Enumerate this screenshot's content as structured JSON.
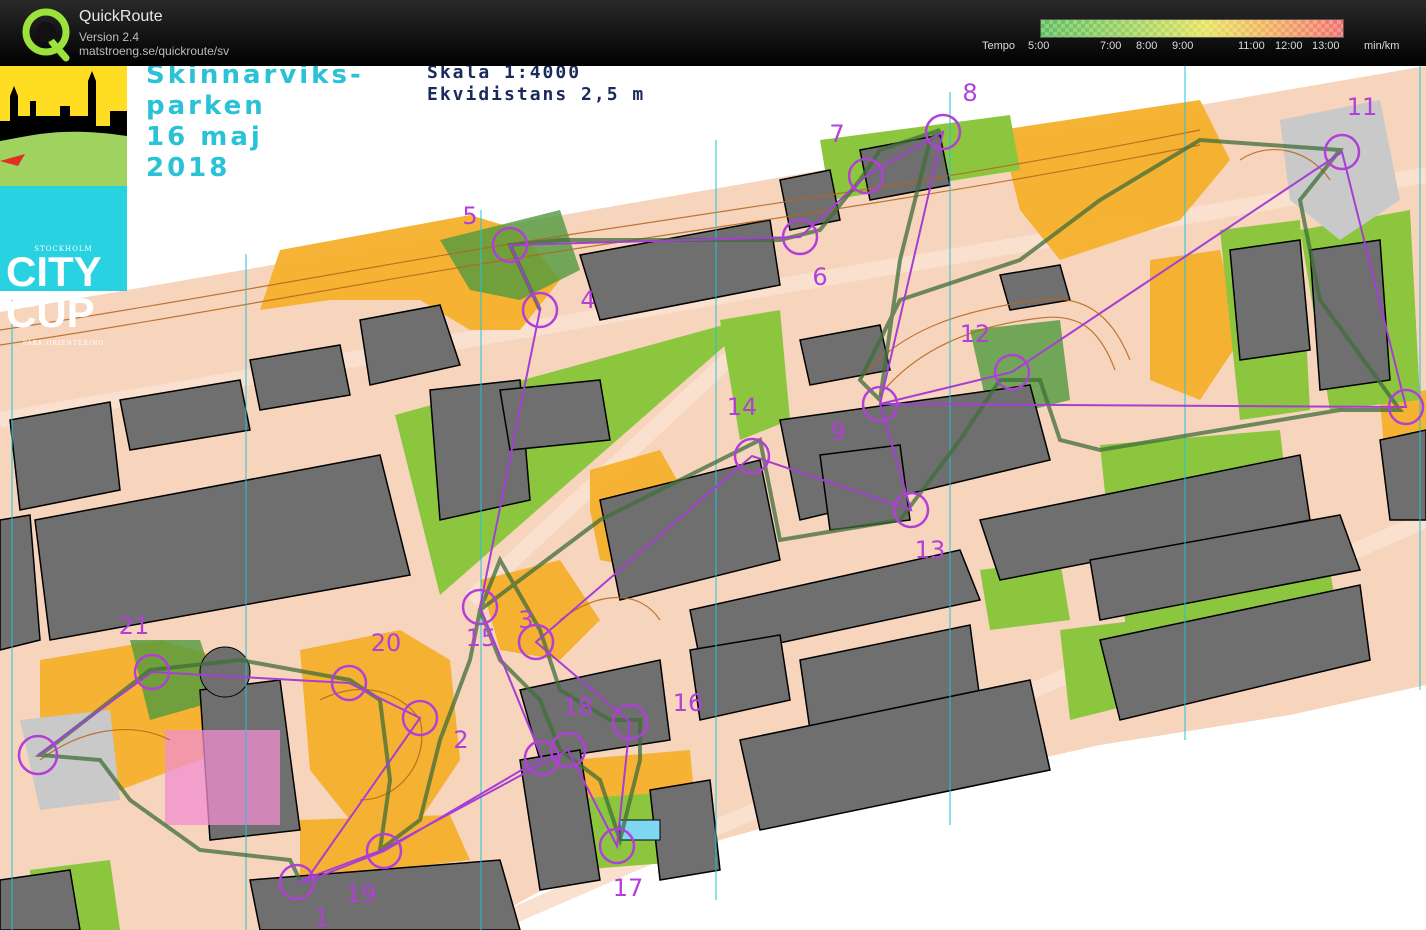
{
  "app": {
    "name": "QuickRoute",
    "version": "Version 2.4",
    "url": "matstroeng.se/quickroute/sv"
  },
  "tempo_legend": {
    "label": "Tempo",
    "ticks": [
      "5:00",
      "7:00",
      "8:00",
      "9:00",
      "11:00",
      "12:00",
      "13:00"
    ],
    "unit": "min/km",
    "colors": [
      "#5fbf5f",
      "#9fd25f",
      "#e6e25f",
      "#f2b15f",
      "#f26f6f"
    ]
  },
  "map": {
    "title_lines": [
      "Skinnarviks-",
      "parken",
      "16 maj",
      "2018"
    ],
    "scale": "Skala 1:4000",
    "equidistance": "Ekvidistans 2,5 m",
    "event_logo": {
      "top": "STOCKHOLM",
      "line1": "CITY",
      "line2": "CUP",
      "bottom": "PARK ORIENTERING"
    },
    "colors": {
      "route": "#a53fd4",
      "control": "#b23fd8",
      "building": "#6f6f6f",
      "paved": "#f7d4bc",
      "open_land": "#f5b02b",
      "green": "#8cc63f",
      "tracked_route": "#3f6e3a",
      "magnetic_north": "#22c3d8"
    },
    "control_numbers": [
      "1",
      "2",
      "3",
      "4",
      "5",
      "6",
      "7",
      "8",
      "9",
      "11",
      "12",
      "13",
      "14",
      "15",
      "16",
      "17",
      "18",
      "19",
      "20",
      "21"
    ]
  }
}
